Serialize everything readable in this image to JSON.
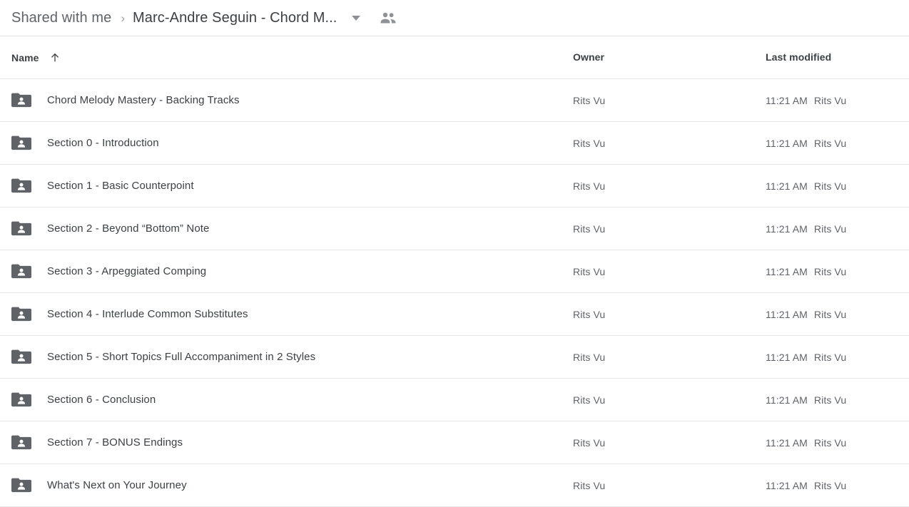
{
  "breadcrumb": {
    "root_label": "Shared with me",
    "separator": "›",
    "current_label": "Marc-Andre Seguin - Chord M...",
    "caret_icon": "chevron-down-icon",
    "people_icon": "people-icon"
  },
  "columns": {
    "name_label": "Name",
    "sort_icon": "arrow-up-icon",
    "owner_label": "Owner",
    "modified_label": "Last modified"
  },
  "files": [
    {
      "icon": "shared-folder-icon",
      "name": "Chord Melody Mastery - Backing Tracks",
      "owner": "Rits Vu",
      "modified_time": "11:21 AM",
      "modified_by": "Rits Vu"
    },
    {
      "icon": "shared-folder-icon",
      "name": "Section 0 - Introduction",
      "owner": "Rits Vu",
      "modified_time": "11:21 AM",
      "modified_by": "Rits Vu"
    },
    {
      "icon": "shared-folder-icon",
      "name": "Section 1 - Basic Counterpoint",
      "owner": "Rits Vu",
      "modified_time": "11:21 AM",
      "modified_by": "Rits Vu"
    },
    {
      "icon": "shared-folder-icon",
      "name": "Section 2 - Beyond “Bottom” Note",
      "owner": "Rits Vu",
      "modified_time": "11:21 AM",
      "modified_by": "Rits Vu"
    },
    {
      "icon": "shared-folder-icon",
      "name": "Section 3 - Arpeggiated Comping",
      "owner": "Rits Vu",
      "modified_time": "11:21 AM",
      "modified_by": "Rits Vu"
    },
    {
      "icon": "shared-folder-icon",
      "name": "Section 4 - Interlude Common Substitutes",
      "owner": "Rits Vu",
      "modified_time": "11:21 AM",
      "modified_by": "Rits Vu"
    },
    {
      "icon": "shared-folder-icon",
      "name": "Section 5 - Short Topics Full Accompaniment in 2 Styles",
      "owner": "Rits Vu",
      "modified_time": "11:21 AM",
      "modified_by": "Rits Vu"
    },
    {
      "icon": "shared-folder-icon",
      "name": "Section 6 - Conclusion",
      "owner": "Rits Vu",
      "modified_time": "11:21 AM",
      "modified_by": "Rits Vu"
    },
    {
      "icon": "shared-folder-icon",
      "name": "Section 7 - BONUS Endings",
      "owner": "Rits Vu",
      "modified_time": "11:21 AM",
      "modified_by": "Rits Vu"
    },
    {
      "icon": "shared-folder-icon",
      "name": "What's Next on Your Journey",
      "owner": "Rits Vu",
      "modified_time": "11:21 AM",
      "modified_by": "Rits Vu"
    }
  ],
  "colors": {
    "text_primary": "#3c4043",
    "text_secondary": "#5f6368",
    "folder_icon": "#5f6368",
    "row_divider": "#e8e8e8",
    "background": "#ffffff"
  }
}
